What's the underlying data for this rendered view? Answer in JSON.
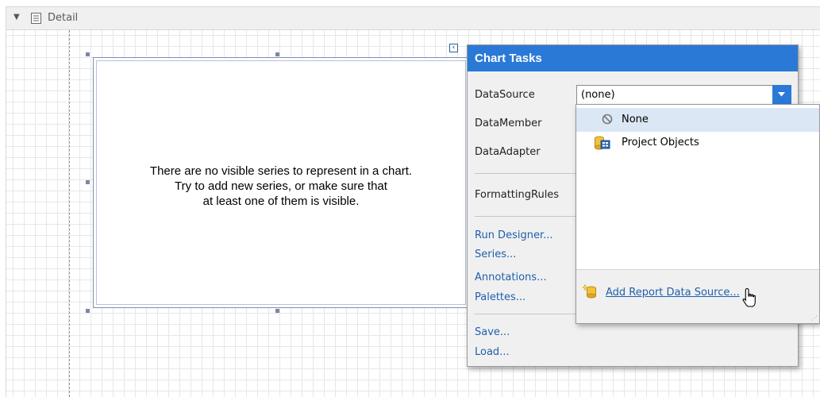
{
  "band": {
    "title": "Detail"
  },
  "chart": {
    "message_lines": [
      "There are no visible series to represent in a chart.",
      "Try to add new series, or make sure that",
      "at least one of them is visible."
    ]
  },
  "tasks_panel": {
    "title": "Chart Tasks",
    "labels": {
      "data_source": "DataSource",
      "data_member": "DataMember",
      "data_adapter": "DataAdapter",
      "formatting_rules": "FormattingRules"
    },
    "data_source_value": "(none)",
    "links_group1": [
      "Run Designer...",
      "Series...",
      "Annotations...",
      "Palettes..."
    ],
    "links_group2": [
      "Save...",
      "Load..."
    ]
  },
  "dropdown": {
    "items": [
      {
        "label": "None",
        "icon": "none-icon",
        "selected": true
      },
      {
        "label": "Project Objects",
        "icon": "project-objects-icon",
        "selected": false
      }
    ],
    "add_label": "Add Report Data Source..."
  },
  "colors": {
    "accent": "#2b79d7",
    "link": "#1f5fae",
    "selection": "#dbe7f5"
  }
}
